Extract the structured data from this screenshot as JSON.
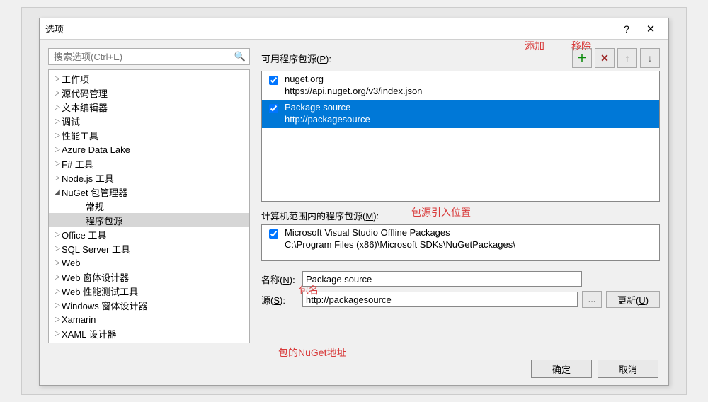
{
  "dialog": {
    "title": "选项"
  },
  "search": {
    "placeholder": "搜索选项(Ctrl+E)"
  },
  "tree": {
    "items": [
      {
        "label": "工作项",
        "level": 0,
        "expander": "▷"
      },
      {
        "label": "源代码管理",
        "level": 0,
        "expander": "▷"
      },
      {
        "label": "文本编辑器",
        "level": 0,
        "expander": "▷"
      },
      {
        "label": "调试",
        "level": 0,
        "expander": "▷"
      },
      {
        "label": "性能工具",
        "level": 0,
        "expander": "▷"
      },
      {
        "label": "Azure Data Lake",
        "level": 0,
        "expander": "▷"
      },
      {
        "label": "F# 工具",
        "level": 0,
        "expander": "▷"
      },
      {
        "label": "Node.js 工具",
        "level": 0,
        "expander": "▷"
      },
      {
        "label": "NuGet 包管理器",
        "level": 0,
        "expander": "◢"
      },
      {
        "label": "常规",
        "level": 1,
        "expander": ""
      },
      {
        "label": "程序包源",
        "level": 1,
        "expander": "",
        "selected": true
      },
      {
        "label": "Office 工具",
        "level": 0,
        "expander": "▷"
      },
      {
        "label": "SQL Server 工具",
        "level": 0,
        "expander": "▷"
      },
      {
        "label": "Web",
        "level": 0,
        "expander": "▷"
      },
      {
        "label": "Web 窗体设计器",
        "level": 0,
        "expander": "▷"
      },
      {
        "label": "Web 性能测试工具",
        "level": 0,
        "expander": "▷"
      },
      {
        "label": "Windows 窗体设计器",
        "level": 0,
        "expander": "▷"
      },
      {
        "label": "Xamarin",
        "level": 0,
        "expander": "▷"
      },
      {
        "label": "XAML 设计器",
        "level": 0,
        "expander": "▷"
      }
    ]
  },
  "sources": {
    "label_prefix": "可用程序包源(",
    "label_key": "P",
    "label_suffix": "):",
    "items": [
      {
        "name": "nuget.org",
        "url": "https://api.nuget.org/v3/index.json",
        "checked": true,
        "selected": false
      },
      {
        "name": "Package source",
        "url": "http://packagesource",
        "checked": true,
        "selected": true
      }
    ],
    "machine_label_prefix": "计算机范围内的程序包源(",
    "machine_label_key": "M",
    "machine_label_suffix": "):",
    "machine_items": [
      {
        "name": "Microsoft Visual Studio Offline Packages",
        "url": "C:\\Program Files (x86)\\Microsoft SDKs\\NuGetPackages\\",
        "checked": true
      }
    ]
  },
  "form": {
    "name_label_prefix": "名称(",
    "name_label_key": "N",
    "name_label_suffix": "):",
    "name_value": "Package source",
    "src_label_prefix": "源(",
    "src_label_key": "S",
    "src_label_suffix": "):",
    "src_value": "http://packagesource",
    "browse": "...",
    "update_prefix": "更新(",
    "update_key": "U",
    "update_suffix": ")"
  },
  "buttons": {
    "ok": "确定",
    "cancel": "取消"
  },
  "icons": {
    "help": "?",
    "close": "✕",
    "search": "🔍",
    "add": "＋",
    "remove": "✕",
    "up": "↑",
    "down": "↓"
  },
  "annotations": {
    "add": "添加",
    "remove": "移除",
    "source_pos": "包源引入位置",
    "pkg_name": "包名",
    "nuget_addr": "包的NuGet地址"
  }
}
